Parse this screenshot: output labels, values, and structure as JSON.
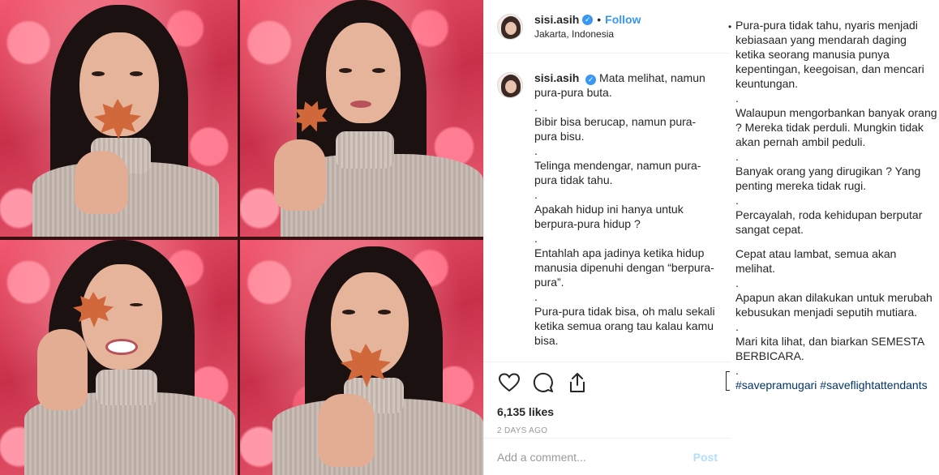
{
  "post_header": {
    "username": "sisi.asih",
    "verified_mark": "✓",
    "separator": "•",
    "follow_label": "Follow",
    "location": "Jakarta, Indonesia"
  },
  "caption": {
    "username": "sisi.asih",
    "verified_mark": "✓",
    "lines": [
      "Mata melihat, namun pura-pura buta.",
      ".",
      "Bibir bisa berucap, namun pura-pura bisu.",
      ".",
      "Telinga mendengar, namun pura-pura tidak tahu.",
      ".",
      "Apakah hidup ini hanya untuk berpura-pura hidup ?",
      ".",
      "Entahlah apa jadinya ketika hidup manusia dipenuhi dengan “berpura-pura”.",
      ".",
      "Pura-pura tidak bisa, oh malu sekali ketika semua orang tau kalau kamu bisa."
    ]
  },
  "caption_continued": {
    "bullet": "•",
    "lines": [
      "Pura-pura tidak tahu, nyaris menjadi kebiasaan yang mendarah daging ketika seorang manusia punya kepentingan, keegoisan, dan mencari keuntungan.",
      ".",
      "Walaupun mengorbankan banyak orang ? Mereka tidak perduli. Mungkin tidak akan pernah ambil peduli.",
      ".",
      "Banyak orang yang dirugikan ? Yang penting mereka tidak rugi.",
      ".",
      "Percayalah, roda kehidupan berputar sangat cepat.",
      "",
      "Cepat atau lambat, semua akan melihat.",
      ".",
      "Apapun akan dilakukan untuk merubah kebusukan menjadi seputih mutiara.",
      ".",
      "Mari kita lihat, dan biarkan SEMESTA BERBICARA.",
      "."
    ],
    "hashtags": [
      "#savepramugari",
      "#saveflightattendants"
    ]
  },
  "actions": {
    "like_icon": "heart-outline-icon",
    "comment_icon": "speech-bubble-icon",
    "share_icon": "share-upload-icon",
    "likes": "6,135 likes",
    "time_ago": "2 DAYS AGO"
  },
  "comment_box": {
    "placeholder": "Add a comment...",
    "post_label": "Post"
  },
  "colors": {
    "accent": "#3897f0",
    "hashtag": "#003569",
    "post_disabled": "#b2dffc",
    "text": "#262626",
    "muted": "#999999",
    "border": "#efefef"
  }
}
